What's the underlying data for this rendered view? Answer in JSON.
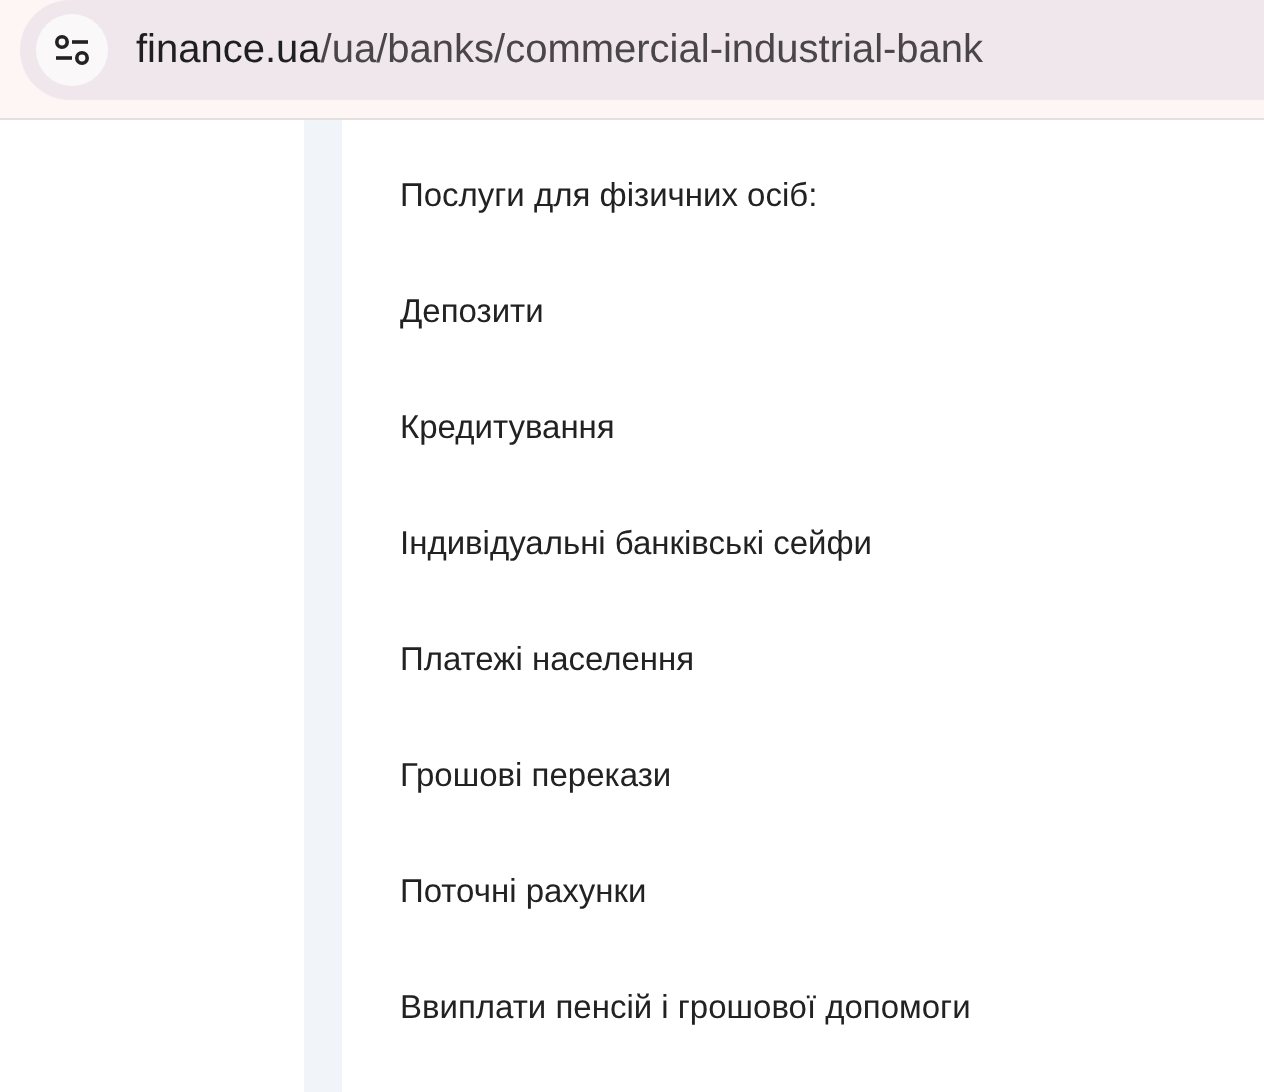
{
  "address_bar": {
    "host": "finance.ua",
    "path": "/ua/banks/commercial-industrial-bank"
  },
  "content": {
    "heading": "Послуги для фізичних осіб:",
    "items": [
      "Депозити",
      "Кредитування",
      "Індивідуальні банківські сейфи",
      "Платежі населення",
      "Грошові перекази",
      "Поточні рахунки",
      "Ввиплати пенсій і грошової допомоги"
    ]
  }
}
